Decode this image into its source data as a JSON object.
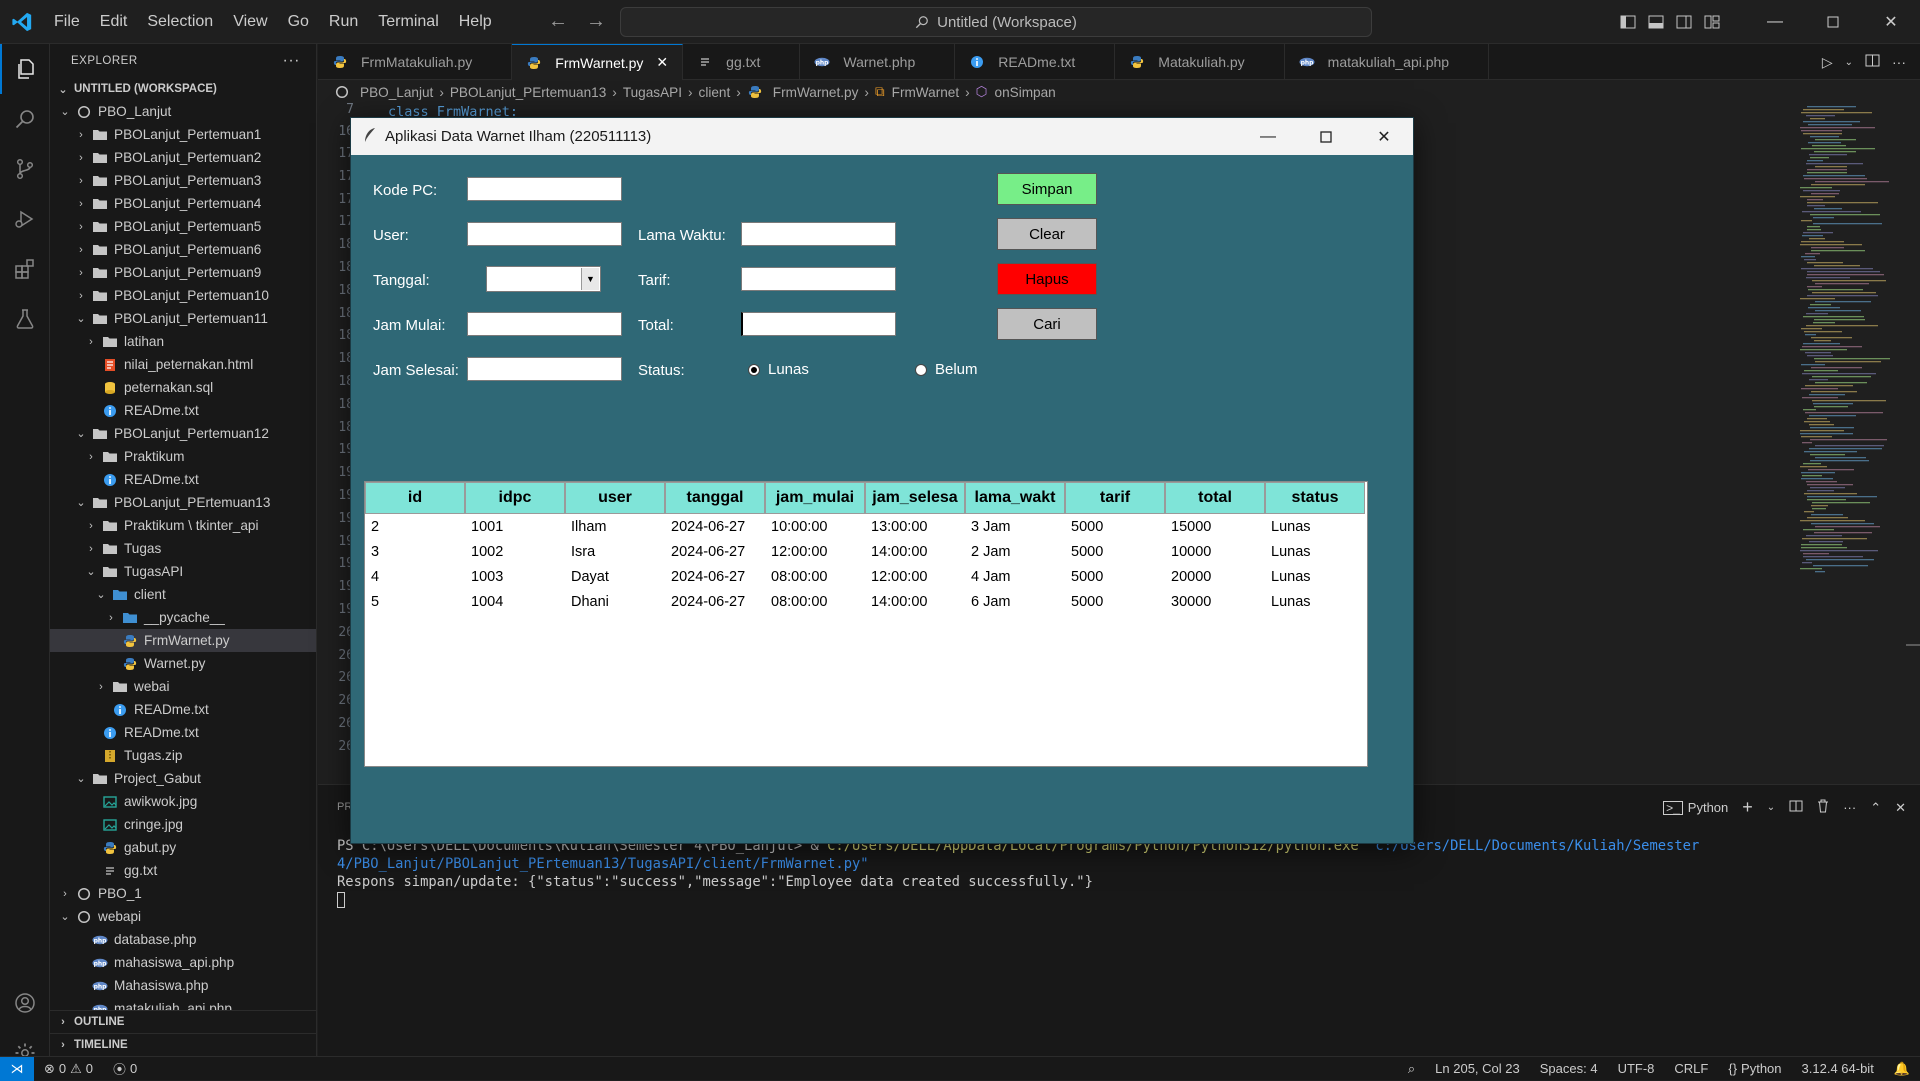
{
  "titlebar": {
    "menu": [
      "File",
      "Edit",
      "Selection",
      "View",
      "Go",
      "Run",
      "Terminal",
      "Help"
    ],
    "command_center": "Untitled (Workspace)"
  },
  "sidebar": {
    "header": "EXPLORER",
    "workspace": "UNTITLED (WORKSPACE)",
    "tree": [
      {
        "label": "PBO_Lanjut",
        "depth": 1,
        "type": "root",
        "open": true
      },
      {
        "label": "PBOLanjut_Pertemuan1",
        "depth": 2,
        "type": "folder",
        "open": false
      },
      {
        "label": "PBOLanjut_Pertemuan2",
        "depth": 2,
        "type": "folder",
        "open": false
      },
      {
        "label": "PBOLanjut_Pertemuan3",
        "depth": 2,
        "type": "folder",
        "open": false
      },
      {
        "label": "PBOLanjut_Pertemuan4",
        "depth": 2,
        "type": "folder",
        "open": false
      },
      {
        "label": "PBOLanjut_Pertemuan5",
        "depth": 2,
        "type": "folder",
        "open": false
      },
      {
        "label": "PBOLanjut_Pertemuan6",
        "depth": 2,
        "type": "folder",
        "open": false
      },
      {
        "label": "PBOLanjut_Pertemuan9",
        "depth": 2,
        "type": "folder",
        "open": false
      },
      {
        "label": "PBOLanjut_Pertemuan10",
        "depth": 2,
        "type": "folder",
        "open": false
      },
      {
        "label": "PBOLanjut_Pertemuan11",
        "depth": 2,
        "type": "folder",
        "open": true
      },
      {
        "label": "latihan",
        "depth": 3,
        "type": "folder",
        "open": false
      },
      {
        "label": "nilai_peternakan.html",
        "depth": 3,
        "type": "html"
      },
      {
        "label": "peternakan.sql",
        "depth": 3,
        "type": "sql"
      },
      {
        "label": "READme.txt",
        "depth": 3,
        "type": "info"
      },
      {
        "label": "PBOLanjut_Pertemuan12",
        "depth": 2,
        "type": "folder",
        "open": true
      },
      {
        "label": "Praktikum",
        "depth": 3,
        "type": "folder",
        "open": false
      },
      {
        "label": "READme.txt",
        "depth": 3,
        "type": "info"
      },
      {
        "label": "PBOLanjut_PErtemuan13",
        "depth": 2,
        "type": "folder",
        "open": true
      },
      {
        "label": "Praktikum \\ tkinter_api",
        "depth": 3,
        "type": "folder",
        "open": false
      },
      {
        "label": "Tugas",
        "depth": 3,
        "type": "folder",
        "open": false
      },
      {
        "label": "TugasAPI",
        "depth": 3,
        "type": "folder",
        "open": true
      },
      {
        "label": "client",
        "depth": 4,
        "type": "folder-blue",
        "open": true
      },
      {
        "label": "__pycache__",
        "depth": 5,
        "type": "folder-blue",
        "open": false
      },
      {
        "label": "FrmWarnet.py",
        "depth": 5,
        "type": "python",
        "selected": true
      },
      {
        "label": "Warnet.py",
        "depth": 5,
        "type": "python"
      },
      {
        "label": "webai",
        "depth": 4,
        "type": "folder",
        "open": false
      },
      {
        "label": "READme.txt",
        "depth": 4,
        "type": "info"
      },
      {
        "label": "READme.txt",
        "depth": 3,
        "type": "info"
      },
      {
        "label": "Tugas.zip",
        "depth": 3,
        "type": "zip"
      },
      {
        "label": "Project_Gabut",
        "depth": 2,
        "type": "folder",
        "open": true
      },
      {
        "label": "awikwok.jpg",
        "depth": 3,
        "type": "image"
      },
      {
        "label": "cringe.jpg",
        "depth": 3,
        "type": "image"
      },
      {
        "label": "gabut.py",
        "depth": 3,
        "type": "python"
      },
      {
        "label": "gg.txt",
        "depth": 3,
        "type": "text"
      },
      {
        "label": "PBO_1",
        "depth": 1,
        "type": "root",
        "open": false
      },
      {
        "label": "webapi",
        "depth": 1,
        "type": "root",
        "open": true
      },
      {
        "label": "database.php",
        "depth": 2,
        "type": "php"
      },
      {
        "label": "mahasiswa_api.php",
        "depth": 2,
        "type": "php"
      },
      {
        "label": "Mahasiswa.php",
        "depth": 2,
        "type": "php"
      },
      {
        "label": "matakuliah_api.php",
        "depth": 2,
        "type": "php"
      }
    ],
    "outline": "OUTLINE",
    "timeline": "TIMELINE"
  },
  "tabs": [
    {
      "label": "FrmMatakuliah.py",
      "type": "python",
      "active": false
    },
    {
      "label": "FrmWarnet.py",
      "type": "python",
      "active": true
    },
    {
      "label": "gg.txt",
      "type": "text",
      "active": false
    },
    {
      "label": "Warnet.php",
      "type": "php",
      "active": false
    },
    {
      "label": "READme.txt",
      "type": "info",
      "active": false
    },
    {
      "label": "Matakuliah.py",
      "type": "python",
      "active": false
    },
    {
      "label": "matakuliah_api.php",
      "type": "php",
      "active": false
    }
  ],
  "breadcrumb": [
    "PBO_Lanjut",
    "PBOLanjut_PErtemuan13",
    "TugasAPI",
    "client",
    "FrmWarnet.py",
    "FrmWarnet",
    "onSimpan"
  ],
  "editor": {
    "visible_code": "class FrmWarnet:",
    "first_line": "7",
    "second_line": "16",
    "line_numbers": [
      "17",
      "17",
      "17",
      "17",
      "18",
      "18",
      "18",
      "18",
      "18",
      "18",
      "18",
      "18",
      "18",
      "19",
      "19",
      "19",
      "19",
      "19",
      "19",
      "19",
      "19",
      "26",
      "26",
      "26",
      "26",
      "26",
      "26"
    ]
  },
  "panel": {
    "terminal_label": "Python",
    "prompt": "PS C:\\Users\\DELL\\Documents\\Kuliah\\Semester 4\\PBO_Lanjut> & ",
    "python_path": "C:/Users/DELL/AppData/Local/Programs/Python/Python312/python.exe",
    "script_path": " \"c:/Users/DELL/Documents/Kuliah/Semester 4/PBO_Lanjut/PBOLanjut_PErtemuan13/TugasAPI/client/FrmWarnet.py\"",
    "output": "Respons simpan/update: {\"status\":\"success\",\"message\":\"Employee data created successfully.\"}"
  },
  "statusbar": {
    "errors": "0",
    "warnings": "0",
    "ports": "0",
    "position": "Ln 205, Col 23",
    "spaces": "Spaces: 4",
    "encoding": "UTF-8",
    "eol": "CRLF",
    "language": "Python",
    "interpreter": "3.12.4 64-bit"
  },
  "app": {
    "title": "Aplikasi Data Warnet Ilham (220511113)",
    "labels": {
      "kode_pc": "Kode PC:",
      "user": "User:",
      "tanggal": "Tanggal:",
      "jam_mulai": "Jam Mulai:",
      "jam_selesai": "Jam Selesai:",
      "lama_waktu": "Lama Waktu:",
      "tarif": "Tarif:",
      "total": "Total:",
      "status": "Status:"
    },
    "fields": {
      "kode_pc": "",
      "user": "",
      "tanggal": "",
      "jam_mulai": "",
      "jam_selesai": "",
      "lama_waktu": "",
      "tarif": "",
      "total": ""
    },
    "radio": {
      "lunas": "Lunas",
      "belum": "Belum",
      "selected": "lunas"
    },
    "buttons": {
      "simpan": {
        "label": "Simpan",
        "color": "#77ee88"
      },
      "clear": {
        "label": "Clear",
        "color": "#c0c0c0"
      },
      "hapus": {
        "label": "Hapus",
        "color": "#ff0000"
      },
      "cari": {
        "label": "Cari",
        "color": "#c0c0c0"
      }
    },
    "table": {
      "columns": [
        "id",
        "idpc",
        "user",
        "tanggal",
        "jam_mulai",
        "jam_selesa",
        "lama_wakt",
        "tarif",
        "total",
        "status"
      ],
      "rows": [
        [
          "2",
          "1001",
          "Ilham",
          "2024-06-27",
          "10:00:00",
          "13:00:00",
          "3 Jam",
          "5000",
          "15000",
          "Lunas"
        ],
        [
          "3",
          "1002",
          "Isra",
          "2024-06-27",
          "12:00:00",
          "14:00:00",
          "2 Jam",
          "5000",
          "10000",
          "Lunas"
        ],
        [
          "4",
          "1003",
          "Dayat",
          "2024-06-27",
          "08:00:00",
          "12:00:00",
          "4 Jam",
          "5000",
          "20000",
          "Lunas"
        ],
        [
          "5",
          "1004",
          "Dhani",
          "2024-06-27",
          "08:00:00",
          "14:00:00",
          "6 Jam",
          "5000",
          "30000",
          "Lunas"
        ]
      ]
    }
  },
  "colors": {
    "accent": "#0078d4",
    "tk_background": "#2f6876",
    "table_header": "#7fe4d8"
  }
}
